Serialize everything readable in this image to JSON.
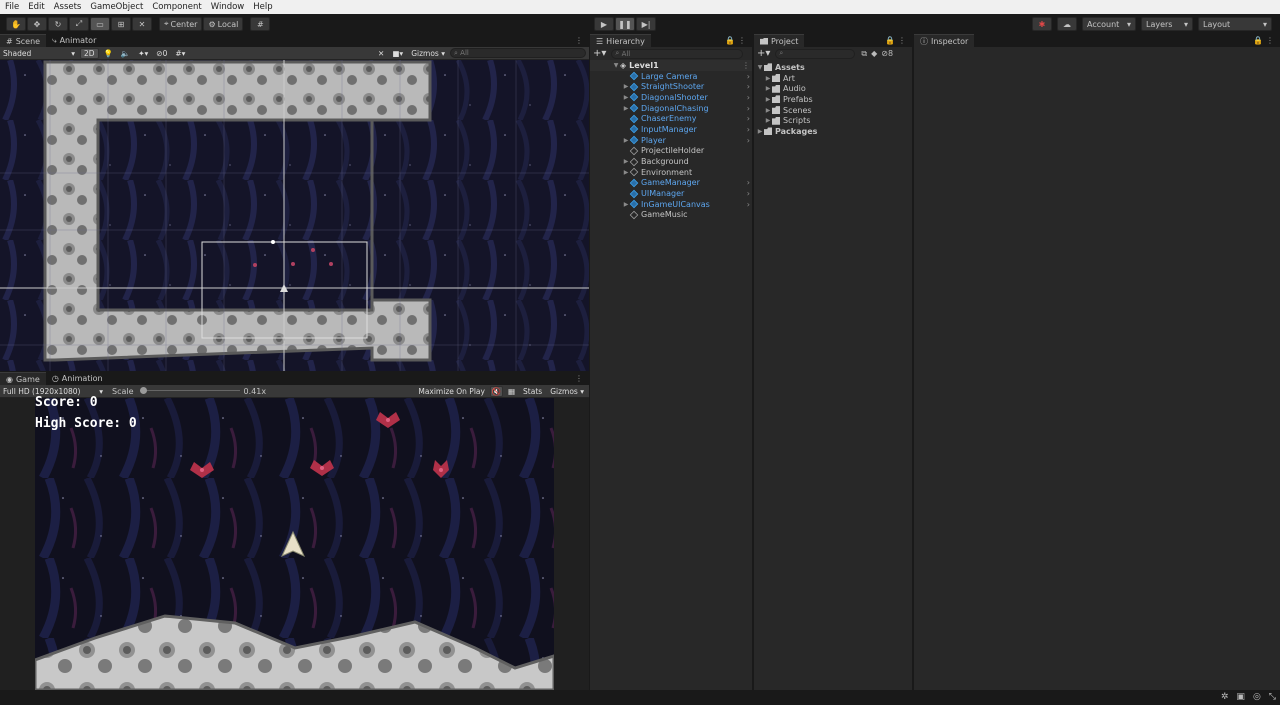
{
  "menu": [
    "File",
    "Edit",
    "Assets",
    "GameObject",
    "Component",
    "Window",
    "Help"
  ],
  "toolbar": {
    "center": "Center",
    "local": "Local",
    "account": "Account",
    "layers": "Layers",
    "layout": "Layout"
  },
  "scene": {
    "tabs": [
      "Scene",
      "Animator"
    ],
    "shading": "Shaded",
    "mode2d": "2D",
    "hidden_count": "0",
    "gizmos": "Gizmos",
    "search_placeholder": "All"
  },
  "game": {
    "tabs": [
      "Game",
      "Animation"
    ],
    "resolution": "Full HD (1920x1080)",
    "scale_label": "Scale",
    "scale_value": "0.41x",
    "maximize": "Maximize On Play",
    "stats": "Stats",
    "gizmos": "Gizmos",
    "score": "Score: 0",
    "high_score": "High Score: 0"
  },
  "hierarchy": {
    "title": "Hierarchy",
    "search_placeholder": "All",
    "scene_name": "Level1",
    "items": [
      {
        "label": "Large Camera",
        "prefab": true,
        "expandable": false,
        "chevron": true
      },
      {
        "label": "StraightShooter",
        "prefab": true,
        "expandable": true,
        "chevron": true
      },
      {
        "label": "DiagonalShooter",
        "prefab": true,
        "expandable": true,
        "chevron": true
      },
      {
        "label": "DiagonalChasing",
        "prefab": true,
        "expandable": true,
        "chevron": true
      },
      {
        "label": "ChaserEnemy",
        "prefab": true,
        "expandable": false,
        "chevron": true
      },
      {
        "label": "InputManager",
        "prefab": true,
        "expandable": false,
        "chevron": true
      },
      {
        "label": "Player",
        "prefab": true,
        "expandable": true,
        "chevron": true
      },
      {
        "label": "ProjectileHolder",
        "prefab": false,
        "expandable": false,
        "chevron": false
      },
      {
        "label": "Background",
        "prefab": false,
        "expandable": true,
        "chevron": false
      },
      {
        "label": "Environment",
        "prefab": false,
        "expandable": true,
        "chevron": false
      },
      {
        "label": "GameManager",
        "prefab": true,
        "expandable": false,
        "chevron": true
      },
      {
        "label": "UIManager",
        "prefab": true,
        "expandable": false,
        "chevron": true
      },
      {
        "label": "InGameUICanvas",
        "prefab": true,
        "expandable": true,
        "chevron": true
      },
      {
        "label": "GameMusic",
        "prefab": false,
        "expandable": false,
        "chevron": false
      }
    ]
  },
  "project": {
    "title": "Project",
    "hidden_count": "8",
    "root": "Assets",
    "folders": [
      "Art",
      "Audio",
      "Prefabs",
      "Scenes",
      "Scripts"
    ],
    "packages": "Packages"
  },
  "inspector": {
    "title": "Inspector"
  }
}
